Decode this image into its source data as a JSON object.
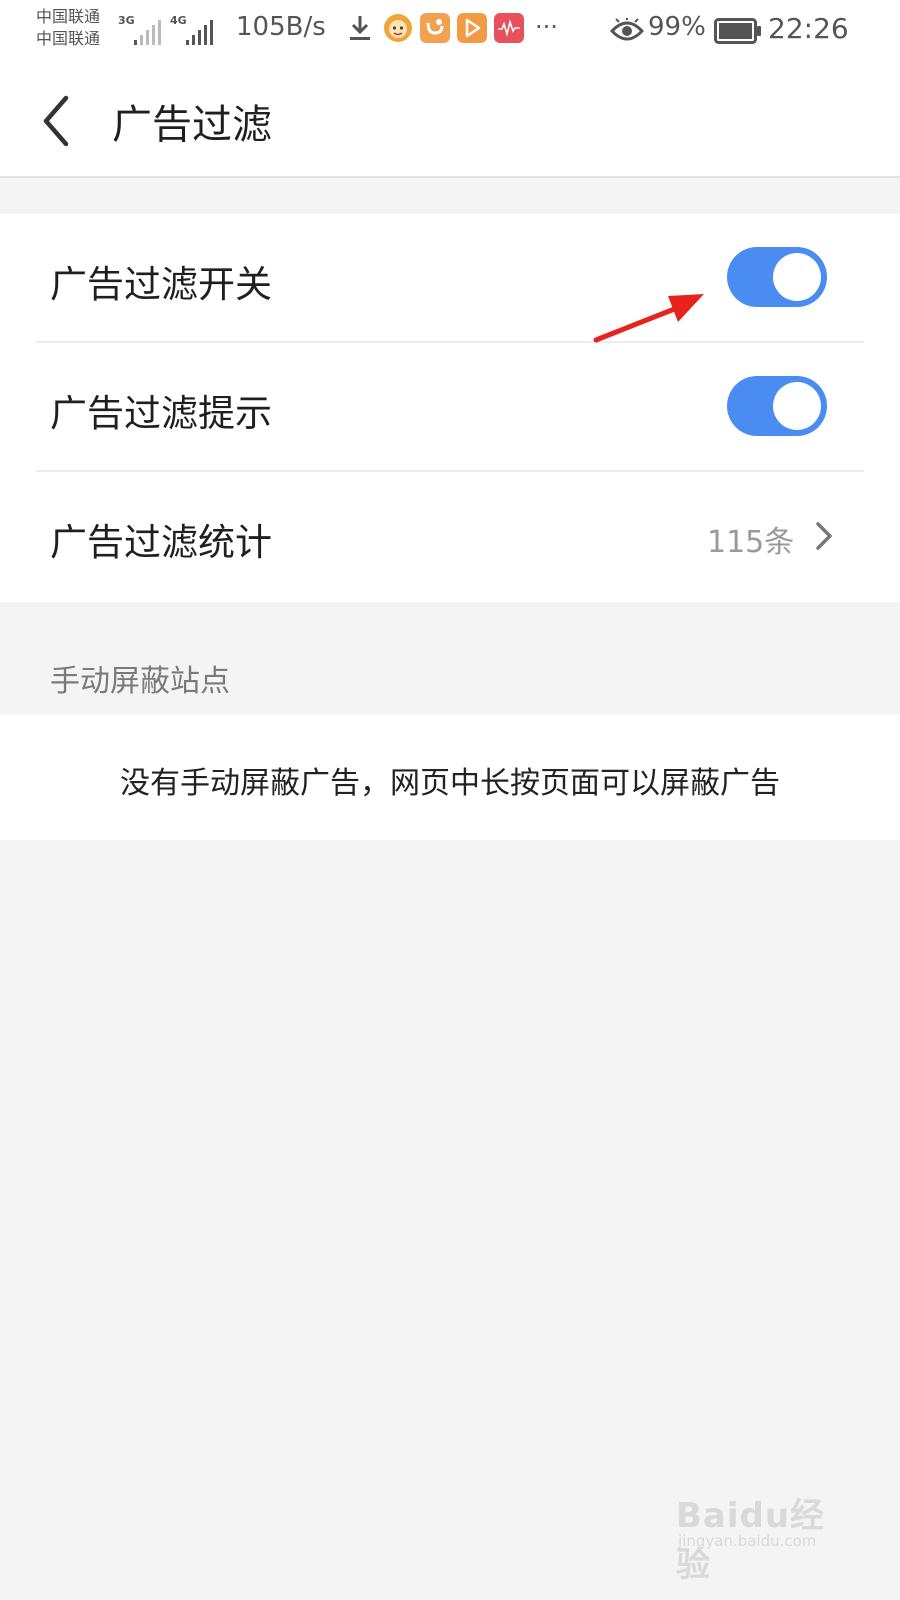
{
  "status_bar": {
    "carrier_1": "中国联通",
    "carrier_2": "中国联通",
    "signal_1_type": "3G",
    "signal_2_type": "4G",
    "net_speed": "105B/s",
    "more": "···",
    "battery_percent": "99%",
    "time": "22:26",
    "icons": [
      "download-icon",
      "cat-app-icon",
      "uc-browser-icon",
      "video-app-icon",
      "music-app-icon",
      "eye-comfort-icon",
      "battery-icon"
    ]
  },
  "header": {
    "title": "广告过滤"
  },
  "settings": {
    "items": [
      {
        "label": "广告过滤开关",
        "toggle_on": true
      },
      {
        "label": "广告过滤提示",
        "toggle_on": true
      },
      {
        "label": "广告过滤统计",
        "value": "115条"
      }
    ]
  },
  "manual_block": {
    "section_title": "手动屏蔽站点",
    "empty_message": "没有手动屏蔽广告，网页中长按页面可以屏蔽广告"
  },
  "watermark": {
    "logo": "Baidu经验",
    "url": "jingyan.baidu.com"
  },
  "colors": {
    "toggle_on": "#4a8cf2",
    "annotation_arrow": "#e8231e",
    "background": "#f4f4f4"
  }
}
